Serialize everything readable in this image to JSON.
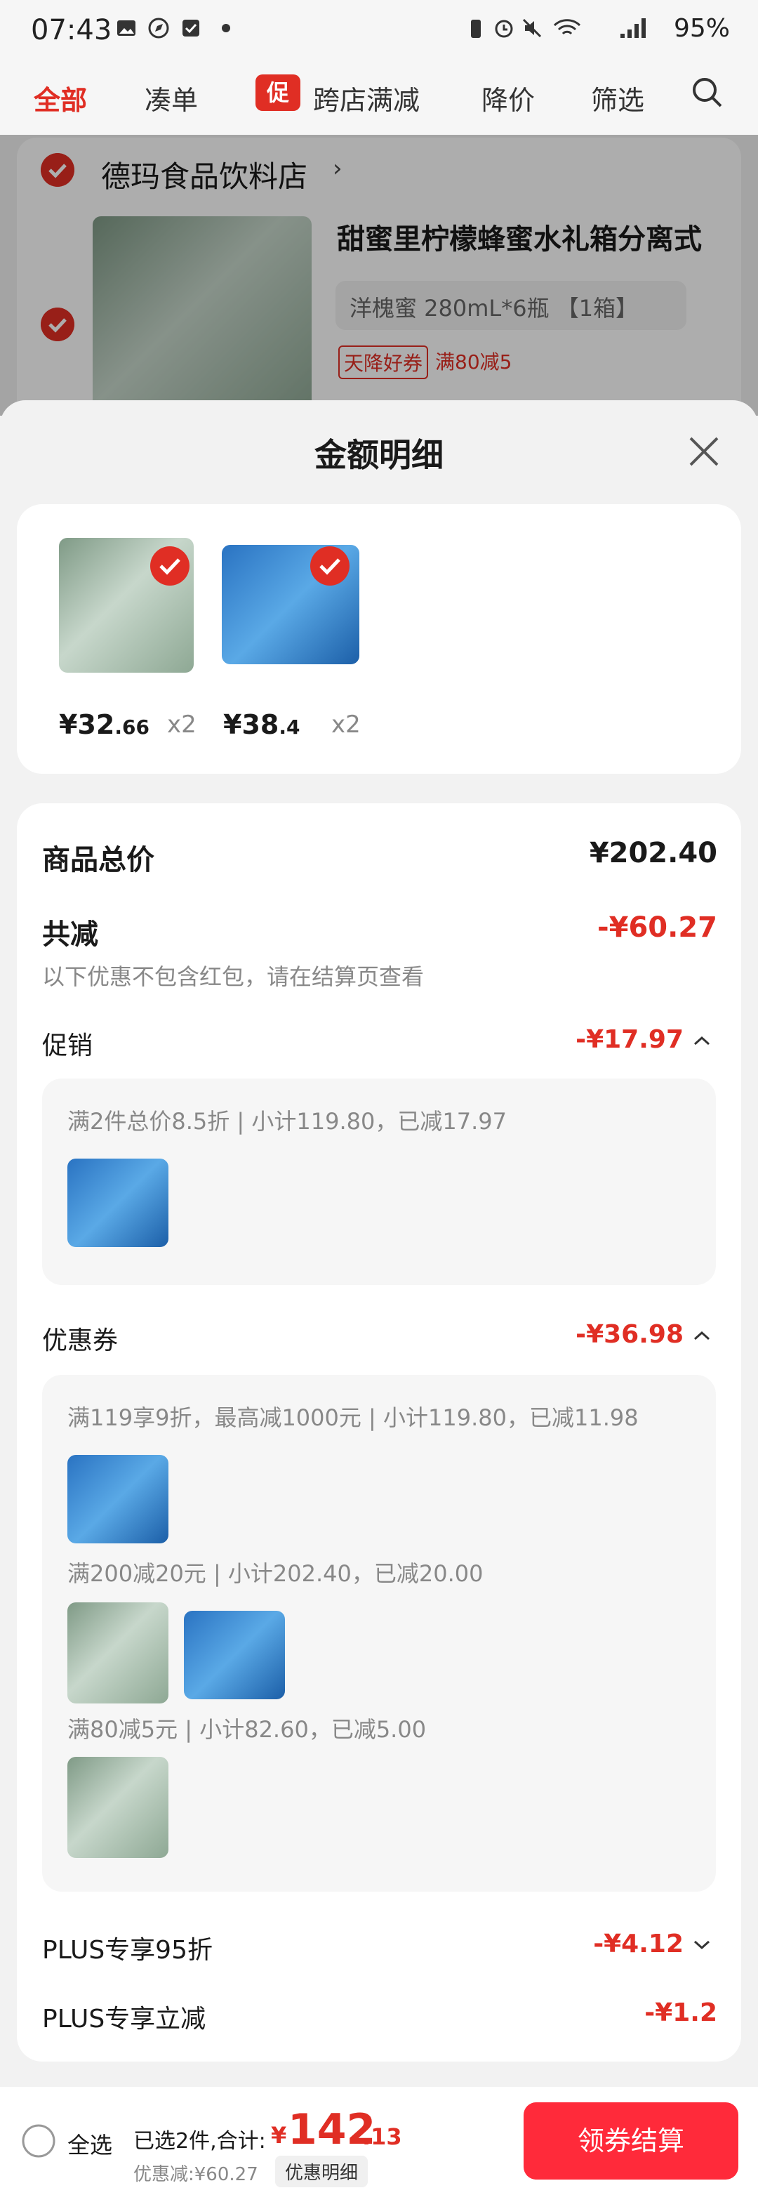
{
  "status_bar": {
    "time": "07:43",
    "battery": "95%"
  },
  "nav": {
    "tabs": [
      "全部",
      "凑单",
      "跨店满减",
      "降价",
      "筛选"
    ],
    "promo_badge": "促"
  },
  "store": {
    "name": "德玛食品饮料店",
    "product_title": "甜蜜里柠檬蜂蜜水礼箱分离式",
    "variant": "洋槐蜜 280mL*6瓶 【1箱】",
    "tag1": "天降好券",
    "tag2": "满80减5"
  },
  "sheet": {
    "title": "金额明细"
  },
  "items": [
    {
      "price_int": "¥32",
      "price_dec": ".66",
      "qty": "x2"
    },
    {
      "price_int": "¥38",
      "price_dec": ".4",
      "qty": "x2"
    }
  ],
  "summary": {
    "total_label": "商品总价",
    "total_value": "¥202.40",
    "reduce_label": "共减",
    "reduce_value": "-¥60.27",
    "reduce_note": "以下优惠不包含红包，请在结算页查看",
    "promo_label": "促销",
    "promo_value": "-¥17.97",
    "promo_rule": "满2件总价8.5折 | 小计119.80，已减17.97",
    "coupon_label": "优惠券",
    "coupon_value": "-¥36.98",
    "coupon_rules": [
      "满119享9折，最高减1000元 | 小计119.80，已减11.98",
      "满200减20元 | 小计202.40，已减20.00",
      "满80减5元 | 小计82.60，已减5.00"
    ],
    "plus_discount_label": "PLUS专享95折",
    "plus_discount_value": "-¥4.12",
    "plus_reduce_label": "PLUS专享立减",
    "plus_reduce_value": "-¥1.2"
  },
  "bottom": {
    "select_all": "全选",
    "selected_text": "已选2件,合计:",
    "total_symbol": "¥",
    "total_int": "142",
    "total_dec": ".13",
    "discount_text": "优惠减:¥60.27",
    "detail_btn": "优惠明细",
    "checkout": "领券结算"
  }
}
